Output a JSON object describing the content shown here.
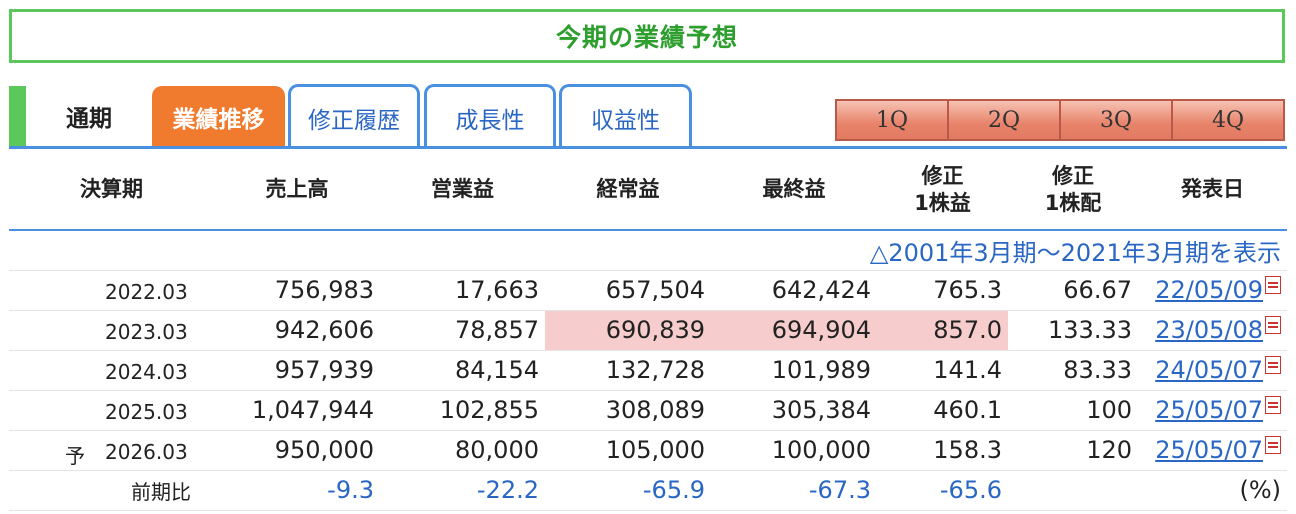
{
  "header": {
    "title": "今期の業績予想"
  },
  "tabs": {
    "fixed_label": "通期",
    "items": [
      {
        "label": "業績推移",
        "active": true
      },
      {
        "label": "修正履歴",
        "active": false
      },
      {
        "label": "成長性",
        "active": false
      },
      {
        "label": "収益性",
        "active": false
      }
    ],
    "quarters": [
      "1Q",
      "2Q",
      "3Q",
      "4Q"
    ]
  },
  "table": {
    "columns": [
      "決算期",
      "売上高",
      "営業益",
      "経常益",
      "最終益",
      "修正\n1株益",
      "修正\n1株配",
      "発表日"
    ],
    "toggle_label": "△2001年3月期～2021年3月期を表示",
    "rows": [
      {
        "prefix": "",
        "period": "2022.03",
        "sales": "756,983",
        "op": "17,663",
        "ord": "657,504",
        "net": "642,424",
        "eps": "765.3",
        "dps": "66.67",
        "date": "22/05/09"
      },
      {
        "prefix": "",
        "period": "2023.03",
        "sales": "942,606",
        "op": "78,857",
        "ord": "690,839",
        "net": "694,904",
        "eps": "857.0",
        "dps": "133.33",
        "date": "23/05/08"
      },
      {
        "prefix": "",
        "period": "2024.03",
        "sales": "957,939",
        "op": "84,154",
        "ord": "132,728",
        "net": "101,989",
        "eps": "141.4",
        "dps": "83.33",
        "date": "24/05/07"
      },
      {
        "prefix": "",
        "period": "2025.03",
        "sales": "1,047,944",
        "op": "102,855",
        "ord": "308,089",
        "net": "305,384",
        "eps": "460.1",
        "dps": "100",
        "date": "25/05/07"
      },
      {
        "prefix": "予",
        "period": "2026.03",
        "sales": "950,000",
        "op": "80,000",
        "ord": "105,000",
        "net": "100,000",
        "eps": "158.3",
        "dps": "120",
        "date": "25/05/07"
      }
    ],
    "ratio_row": {
      "label": "前期比",
      "sales": "-9.3",
      "op": "-22.2",
      "ord": "-65.9",
      "net": "-67.3",
      "eps": "-65.6",
      "dps": "",
      "unit": "(%)"
    }
  },
  "colors": {
    "green": "#5cc85c",
    "orange": "#f07b2e",
    "blue": "#4a90e0",
    "highlight": "#f6cccc"
  }
}
